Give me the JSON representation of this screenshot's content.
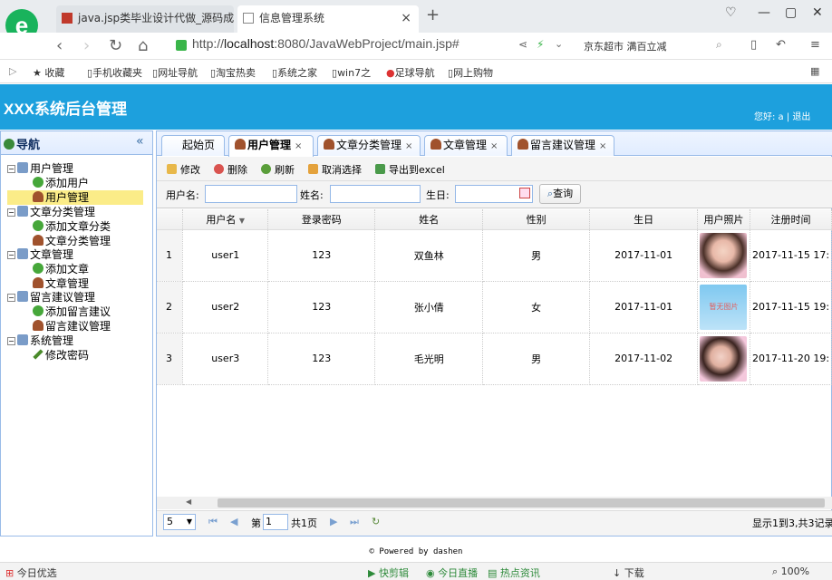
{
  "browser": {
    "tabs": [
      {
        "title": "java.jsp类毕业设计代做_源码成品"
      },
      {
        "title": "信息管理系统"
      }
    ],
    "url_prefix": "http://",
    "url_host": "localhost",
    "url_rest": ":8080/JavaWebProject/main.jsp#",
    "suggest_text": "京东超市 满百立减",
    "bookmarks": [
      "收藏",
      "手机收藏夹",
      "网址导航",
      "淘宝热卖",
      "系统之家",
      "win7之",
      "足球导航",
      "网上购物"
    ],
    "status_left": "今日优选",
    "status_items": [
      "快剪辑",
      "今日直播",
      "热点资讯",
      "下载",
      "100%"
    ]
  },
  "app": {
    "title": "XXX系统后台管理",
    "greeting": "您好: a",
    "logout": "退出",
    "footer": "© Powered by dashen"
  },
  "nav": {
    "title": "导航",
    "tree": [
      {
        "label": "用户管理",
        "level": 0,
        "icon": "folder"
      },
      {
        "label": "添加用户",
        "level": 1,
        "icon": "plus"
      },
      {
        "label": "用户管理",
        "level": 1,
        "icon": "user",
        "selected": true
      },
      {
        "label": "文章分类管理",
        "level": 0,
        "icon": "folder"
      },
      {
        "label": "添加文章分类",
        "level": 1,
        "icon": "plus"
      },
      {
        "label": "文章分类管理",
        "level": 1,
        "icon": "user"
      },
      {
        "label": "文章管理",
        "level": 0,
        "icon": "folder"
      },
      {
        "label": "添加文章",
        "level": 1,
        "icon": "plus"
      },
      {
        "label": "文章管理",
        "level": 1,
        "icon": "user"
      },
      {
        "label": "留言建议管理",
        "level": 0,
        "icon": "folder"
      },
      {
        "label": "添加留言建议",
        "level": 1,
        "icon": "plus"
      },
      {
        "label": "留言建议管理",
        "level": 1,
        "icon": "user"
      },
      {
        "label": "系统管理",
        "level": 0,
        "icon": "folder"
      },
      {
        "label": "修改密码",
        "level": 1,
        "icon": "pen"
      }
    ]
  },
  "tabs": [
    {
      "label": "起始页",
      "closable": false
    },
    {
      "label": "用户管理",
      "closable": true,
      "active": true
    },
    {
      "label": "文章分类管理",
      "closable": true
    },
    {
      "label": "文章管理",
      "closable": true
    },
    {
      "label": "留言建议管理",
      "closable": true
    }
  ],
  "toolbar": {
    "edit": "修改",
    "delete": "删除",
    "refresh": "刷新",
    "unselect": "取消选择",
    "export": "导出到excel"
  },
  "search": {
    "username_label": "用户名:",
    "name_label": "姓名:",
    "birthday_label": "生日:",
    "query_button": "查询"
  },
  "grid": {
    "columns": [
      "用户名",
      "登录密码",
      "姓名",
      "性别",
      "生日",
      "用户照片",
      "注册时间"
    ],
    "rows": [
      {
        "num": "1",
        "username": "user1",
        "password": "123",
        "name": "双鱼林",
        "sex": "男",
        "birthday": "2017-11-01",
        "photo_text": "",
        "regtime": "2017-11-15 17:"
      },
      {
        "num": "2",
        "username": "user2",
        "password": "123",
        "name": "张小倩",
        "sex": "女",
        "birthday": "2017-11-01",
        "photo_text": "暂无图片",
        "regtime": "2017-11-15 19:"
      },
      {
        "num": "3",
        "username": "user3",
        "password": "123",
        "name": "毛光明",
        "sex": "男",
        "birthday": "2017-11-02",
        "photo_text": "",
        "regtime": "2017-11-20 19:"
      }
    ]
  },
  "pager": {
    "page_size": "5",
    "page_prefix": "第",
    "page_value": "1",
    "page_total": "共1页",
    "summary": "显示1到3,共3记录"
  },
  "colors": {
    "header_bg": "#1da0dd",
    "panel_border": "#99bbe8",
    "selected_row": "#fbec88"
  }
}
